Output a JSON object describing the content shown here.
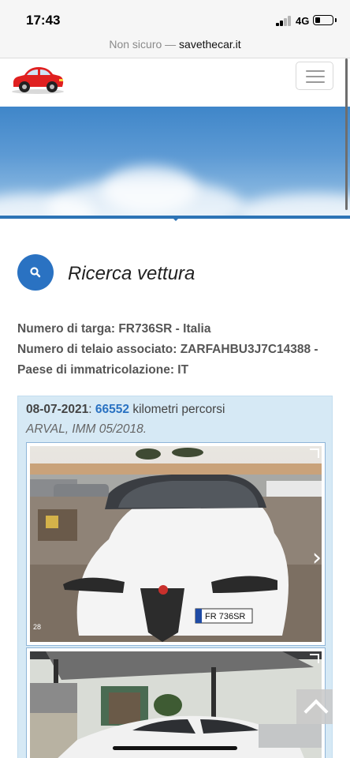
{
  "status_bar": {
    "time": "17:43",
    "network": "4G",
    "battery_level": 0.3
  },
  "browser": {
    "insecure_label": "Non sicuro —",
    "domain": "savethecar.it"
  },
  "header": {
    "logo_icon": "red-car-icon",
    "menu_icon": "hamburger-icon"
  },
  "page": {
    "title": "Ricerca vettura",
    "search_icon": "search-icon"
  },
  "vehicle": {
    "plate_line": "Numero di targa: FR736SR - Italia",
    "chassis_line": "Numero di telaio associato: ZARFAHBU3J7C14388 -",
    "country_line": "Paese di immatricolazione: IT"
  },
  "record": {
    "date": "08-07-2021",
    "separator": ":",
    "km": "66552",
    "km_label": " kilometri percorsi",
    "note": "ARVAL, IMM 05/2018.",
    "photo1": {
      "plate_text": "FR 736SR",
      "counter": "28"
    }
  },
  "colors": {
    "accent": "#2a72c2",
    "card_background": "#d6e9f5",
    "logo_red": "#e02020"
  }
}
